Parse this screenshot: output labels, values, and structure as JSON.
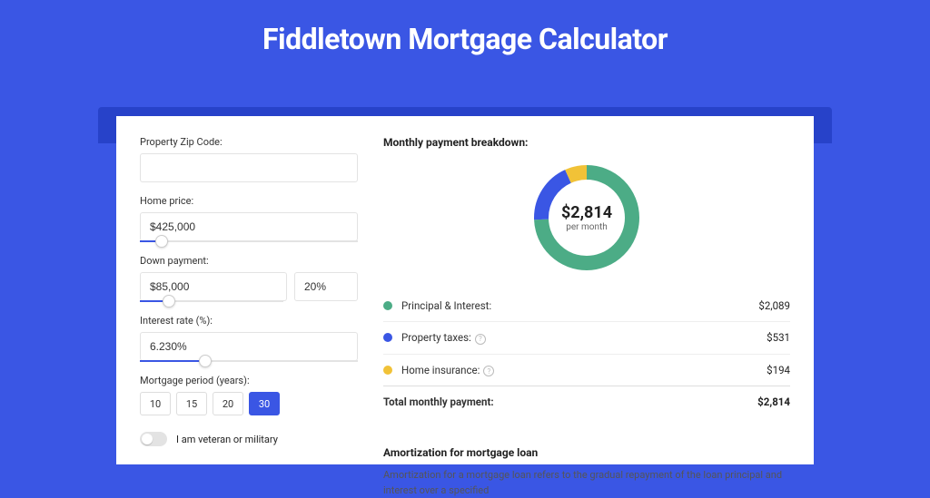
{
  "title": "Fiddletown Mortgage Calculator",
  "form": {
    "zip_label": "Property Zip Code:",
    "zip_value": "",
    "home_price_label": "Home price:",
    "home_price_value": "$425,000",
    "home_price_pct": 10,
    "down_label": "Down payment:",
    "down_value": "$85,000",
    "down_pct_value": "20%",
    "down_slider_pct": 20,
    "rate_label": "Interest rate (%):",
    "rate_value": "6.230%",
    "rate_slider_pct": 30,
    "period_label": "Mortgage period (years):",
    "periods": [
      "10",
      "15",
      "20",
      "30"
    ],
    "period_active": "30",
    "veteran_label": "I am veteran or military"
  },
  "breakdown": {
    "title": "Monthly payment breakdown:",
    "total_amount": "$2,814",
    "total_sub": "per month",
    "items": [
      {
        "label": "Principal & Interest:",
        "value": "$2,089",
        "color": "#4cac86"
      },
      {
        "label": "Property taxes:",
        "value": "$531",
        "color": "#3a56e4",
        "info": true
      },
      {
        "label": "Home insurance:",
        "value": "$194",
        "color": "#f1c237",
        "info": true
      }
    ],
    "total_label": "Total monthly payment:",
    "total_value": "$2,814"
  },
  "chart_data": {
    "type": "pie",
    "title": "Monthly payment breakdown",
    "series": [
      {
        "name": "Principal & Interest",
        "value": 2089,
        "color": "#4cac86"
      },
      {
        "name": "Property taxes",
        "value": 531,
        "color": "#3a56e4"
      },
      {
        "name": "Home insurance",
        "value": 194,
        "color": "#f1c237"
      }
    ],
    "total": 2814,
    "center_label": "$2,814 per month"
  },
  "amort": {
    "title": "Amortization for mortgage loan",
    "text": "Amortization for a mortgage loan refers to the gradual repayment of the loan principal and interest over a specified"
  }
}
